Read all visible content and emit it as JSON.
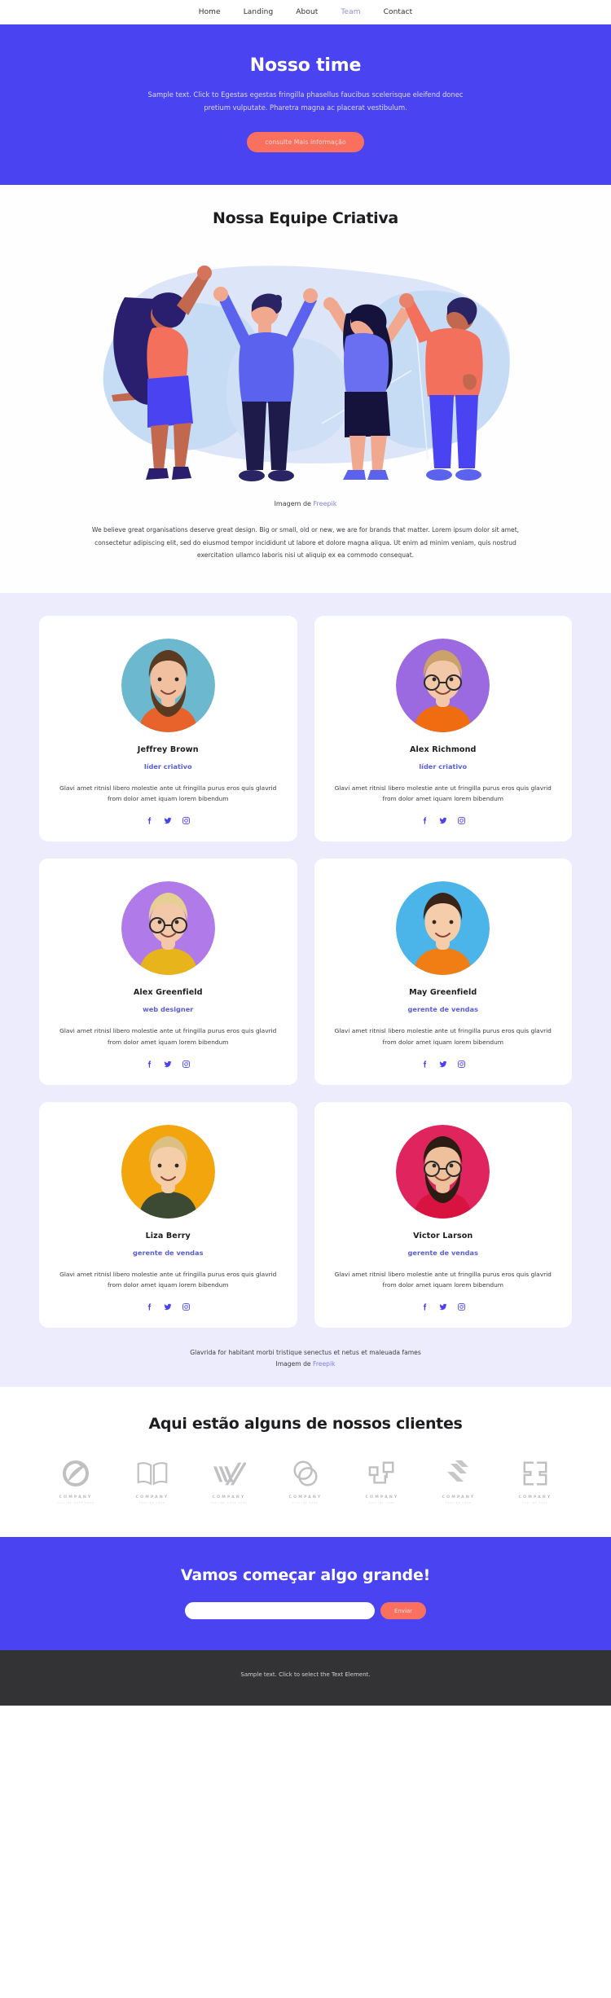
{
  "nav": {
    "items": [
      {
        "label": "Home",
        "active": false
      },
      {
        "label": "Landing",
        "active": false
      },
      {
        "label": "About",
        "active": false
      },
      {
        "label": "Team",
        "active": true
      },
      {
        "label": "Contact",
        "active": false
      }
    ]
  },
  "hero": {
    "title": "Nosso time",
    "subtitle": "Sample text. Click to Egestas egestas fringilla phasellus faucibus scelerisque eleifend donec pretium vulputate. Pharetra magna ac placerat vestibulum.",
    "button": "consulte Mais informação",
    "bg_color": "#4a43f2",
    "button_color": "#f9705f"
  },
  "creative": {
    "title": "Nossa Equipe Criativa",
    "credit_prefix": "Imagem de ",
    "credit_link": "Freepik",
    "paragraph": "We believe great organisations deserve great design. Big or small, old or new, we are for brands that matter. Lorem ipsum dolor sit amet, consectetur adipiscing elit, sed do eiusmod tempor incididunt ut labore et dolore magna aliqua. Ut enim ad minim veniam, quis nostrud exercitation ullamco laboris nisi ut aliquip ex ea commodo consequat."
  },
  "team": {
    "members": [
      {
        "name": "Jeffrey Brown",
        "role": "líder criativo",
        "desc": "Glavi amet ritnisl libero molestie ante ut fringilla purus eros quis glavrid from dolor amet iquam lorem bibendum",
        "bg": "#6cb8cf",
        "shirt": "#e8622c",
        "hair": "#5b3a22",
        "skin": "#f0c0a0",
        "beard": true,
        "glasses": false
      },
      {
        "name": "Alex Richmond",
        "role": "líder criativo",
        "desc": "Glavi amet ritnisl libero molestie ante ut fringilla purus eros quis glavrid from dolor amet iquam lorem bibendum",
        "bg": "#9b6ae0",
        "shirt": "#ef6c11",
        "hair": "#caa26a",
        "skin": "#f3c8a8",
        "beard": false,
        "glasses": true
      },
      {
        "name": "Alex Greenfield",
        "role": "web designer",
        "desc": "Glavi amet ritnisl libero molestie ante ut fringilla purus eros quis glavrid from dolor amet iquam lorem bibendum",
        "bg": "#b07ae8",
        "shirt": "#e8b41c",
        "hair": "#e6cf92",
        "skin": "#f3c8a8",
        "beard": false,
        "glasses": true
      },
      {
        "name": "May Greenfield",
        "role": "gerente de vendas",
        "desc": "Glavi amet ritnisl libero molestie ante ut fringilla purus eros quis glavrid from dolor amet iquam lorem bibendum",
        "bg": "#4bb4e8",
        "shirt": "#f07e14",
        "hair": "#3a2418",
        "skin": "#f5cdaa",
        "beard": false,
        "glasses": false
      },
      {
        "name": "Liza Berry",
        "role": "gerente de vendas",
        "desc": "Glavi amet ritnisl libero molestie ante ut fringilla purus eros quis glavrid from dolor amet iquam lorem bibendum",
        "bg": "#f2a50c",
        "shirt": "#3c4a34",
        "hair": "#dcc082",
        "skin": "#f4cda9",
        "beard": false,
        "glasses": false
      },
      {
        "name": "Victor Larson",
        "role": "gerente de vendas",
        "desc": "Glavi amet ritnisl libero molestie ante ut fringilla purus eros quis glavrid from dolor amet iquam lorem bibendum",
        "bg": "#e0245e",
        "shirt": "#d8133f",
        "hair": "#2b1c14",
        "skin": "#eec09b",
        "beard": true,
        "glasses": true
      }
    ],
    "socials": [
      "facebook-icon",
      "twitter-icon",
      "instagram-icon"
    ],
    "social_color": "#4a43f2",
    "footnote": "Glavrida for habitant morbi tristique senectus et netus et maleuada fames",
    "footnote_credit_prefix": "Imagem de ",
    "footnote_credit_link": "Freepik"
  },
  "clients": {
    "title": "Aqui estão alguns de nossos clientes",
    "logos": [
      {
        "name": "COMPANY",
        "tagline": "TAGLINE GOES HERE",
        "mark": "ellipse-swirl"
      },
      {
        "name": "COMPANY",
        "tagline": "TAGLINE HERE",
        "mark": "open-book"
      },
      {
        "name": "COMPANY",
        "tagline": "TAGLINE GOES HERE",
        "mark": "chevron-lines"
      },
      {
        "name": "COMPANY",
        "tagline": "TAGLINE HERE",
        "mark": "circle-swirl"
      },
      {
        "name": "COMPANY",
        "tagline": "TAGLINE HERE",
        "mark": "linked-squares"
      },
      {
        "name": "COMPANY",
        "tagline": "TAGLINE HERE",
        "mark": "diagonal-slashes"
      },
      {
        "name": "COMPANY",
        "tagline": "TAGLINE HERE",
        "mark": "double-bracket"
      }
    ]
  },
  "cta": {
    "title": "Vamos começar algo grande!",
    "input_value": "",
    "input_placeholder": "",
    "submit": "Enviar"
  },
  "footer": {
    "text": "Sample text. Click to select the Text Element."
  }
}
